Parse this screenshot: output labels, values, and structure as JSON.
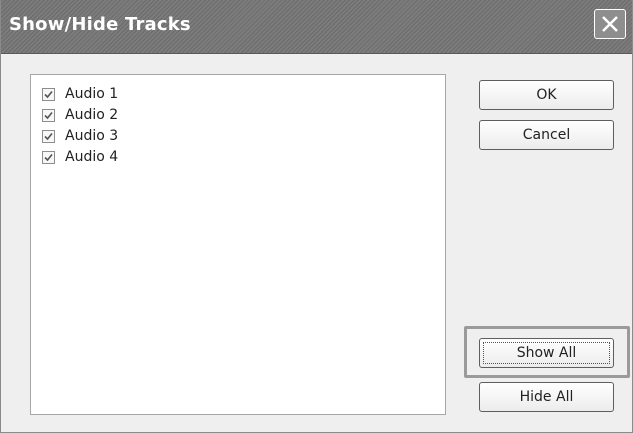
{
  "window": {
    "title": "Show/Hide Tracks",
    "close_icon": "close-icon"
  },
  "tracks": [
    {
      "label": "Audio 1",
      "checked": true
    },
    {
      "label": "Audio 2",
      "checked": true
    },
    {
      "label": "Audio 3",
      "checked": true
    },
    {
      "label": "Audio 4",
      "checked": true
    }
  ],
  "buttons": {
    "ok": "OK",
    "cancel": "Cancel",
    "show_all": "Show All",
    "hide_all": "Hide All"
  }
}
